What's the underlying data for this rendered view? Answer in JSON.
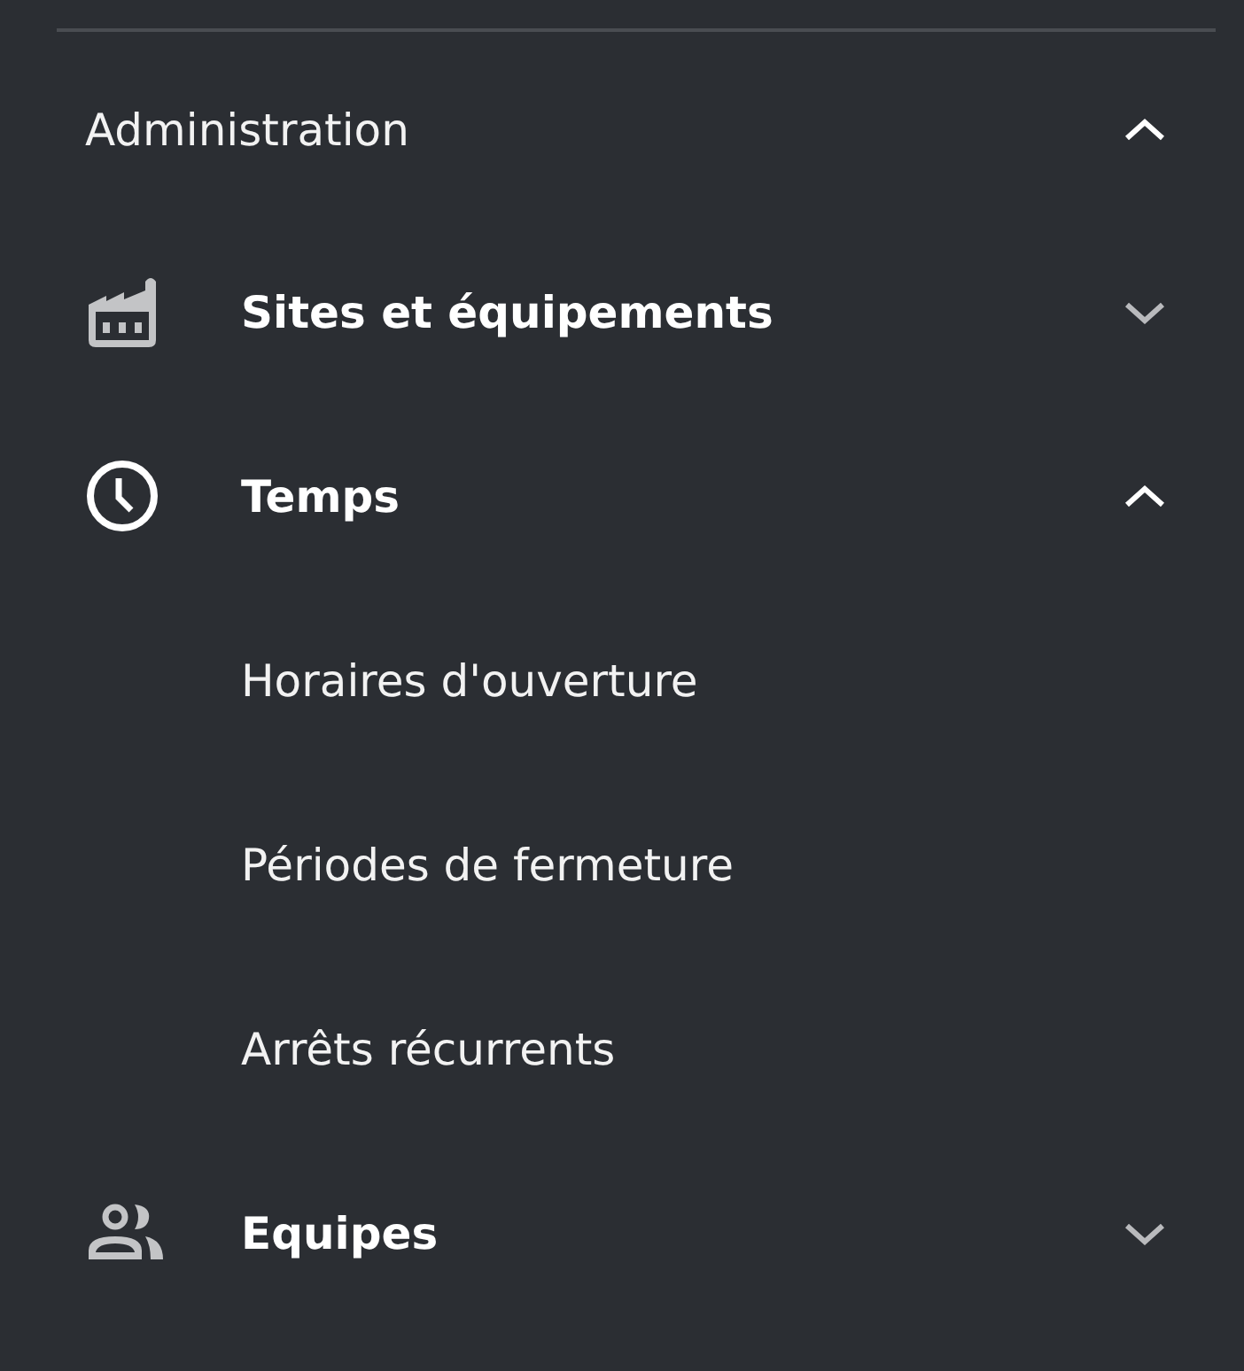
{
  "section": {
    "title": "Administration",
    "expanded": true
  },
  "items": [
    {
      "label": "Sites et équipements",
      "kind": "factory",
      "expanded": false
    },
    {
      "label": "Temps",
      "kind": "clock",
      "expanded": true,
      "children": [
        {
          "label": "Horaires d'ouverture"
        },
        {
          "label": "Périodes de fermeture"
        },
        {
          "label": "Arrêts récurrents"
        }
      ]
    },
    {
      "label": "Equipes",
      "kind": "people",
      "expanded": false
    }
  ]
}
